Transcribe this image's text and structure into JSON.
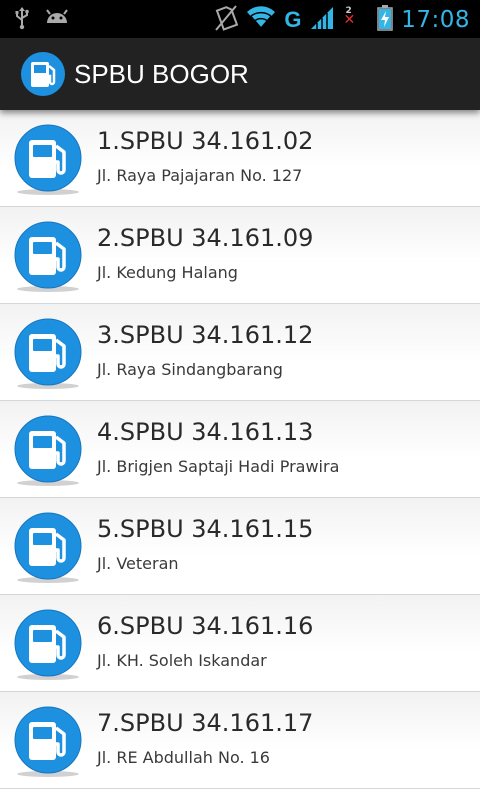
{
  "status_bar": {
    "time": "17:08",
    "network_type": "G",
    "sim_badge": "2",
    "icons": [
      "usb-icon",
      "android-icon",
      "no-sim-icon",
      "wifi-icon",
      "signal-icon",
      "battery-charging-icon"
    ]
  },
  "action_bar": {
    "title": "SPBU BOGOR",
    "icon": "fuel-pump-icon"
  },
  "colors": {
    "accent": "#33b5e5",
    "icon_blue": "#1e90e0",
    "actionbar_bg": "#222222"
  },
  "list": {
    "items": [
      {
        "name": "1.SPBU 34.161.02",
        "address": "Jl. Raya Pajajaran No. 127"
      },
      {
        "name": "2.SPBU 34.161.09",
        "address": "Jl. Kedung Halang"
      },
      {
        "name": "3.SPBU 34.161.12",
        "address": "Jl. Raya Sindangbarang"
      },
      {
        "name": "4.SPBU 34.161.13",
        "address": "Jl. Brigjen Saptaji Hadi Prawira"
      },
      {
        "name": "5.SPBU 34.161.15",
        "address": "Jl. Veteran"
      },
      {
        "name": "6.SPBU 34.161.16",
        "address": "Jl. KH. Soleh Iskandar"
      },
      {
        "name": "7.SPBU 34.161.17",
        "address": "Jl. RE Abdullah No. 16"
      }
    ]
  }
}
